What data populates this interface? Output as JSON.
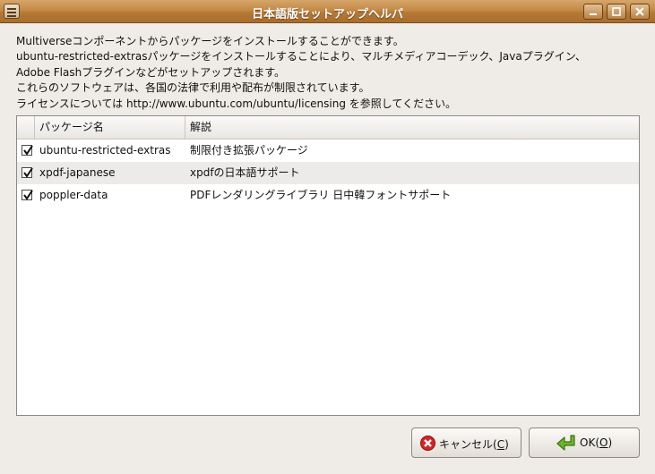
{
  "window": {
    "title": "日本語版セットアップヘルパ"
  },
  "description": {
    "lines": [
      "Multiverseコンポーネントからパッケージをインストールすることができます。",
      "ubuntu-restricted-extrasパッケージをインストールすることにより、マルチメディアコーデック、Javaプラグイン、",
      "Adobe Flashプラグインなどがセットアップされます。",
      "これらのソフトウェアは、各国の法律で利用や配布が制限されています。",
      "ライセンスについては http://www.ubuntu.com/ubuntu/licensing を参照してください。"
    ]
  },
  "table": {
    "columns": [
      "パッケージ名",
      "解説"
    ],
    "rows": [
      {
        "checked": true,
        "name": "ubuntu-restricted-extras",
        "desc": "制限付き拡張パッケージ"
      },
      {
        "checked": true,
        "name": "xpdf-japanese",
        "desc": "xpdfの日本語サポート"
      },
      {
        "checked": true,
        "name": "poppler-data",
        "desc": "PDFレンダリングライブラリ 日中韓フォントサポート"
      }
    ]
  },
  "buttons": {
    "cancel": {
      "label": "キャンセル(",
      "mnemonic": "C",
      "close": ")",
      "icon": "cancel-icon"
    },
    "ok": {
      "label": "OK(",
      "mnemonic": "O",
      "close": ")",
      "icon": "ok-arrow-icon"
    }
  },
  "colors": {
    "titlebar": "#c48a45",
    "background": "#efebe7",
    "cancel_icon": "#d62424",
    "ok_icon": "#5fa31f"
  }
}
